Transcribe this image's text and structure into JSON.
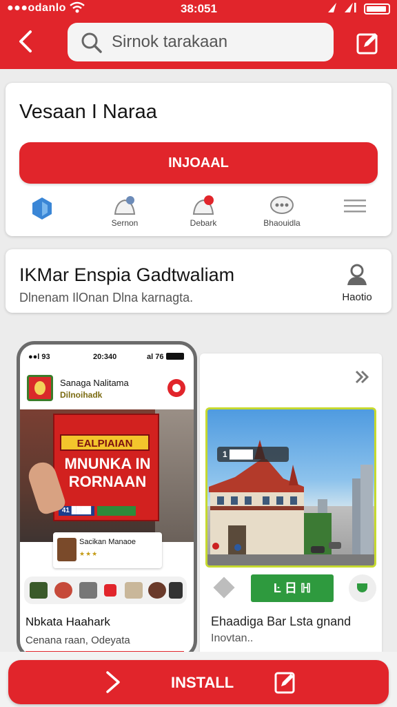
{
  "status_bar": {
    "carrier": "●●●odanlo",
    "time": "38:051"
  },
  "header": {
    "search_placeholder": "Sirnok tarakaan"
  },
  "app": {
    "title": "Vesaan  I Naraa",
    "install_label": "INJOAAL",
    "actions": [
      {
        "label": "",
        "icon": "shield-icon"
      },
      {
        "label": "Sernon",
        "icon": "bell-icon"
      },
      {
        "label": "Debark",
        "icon": "notification-bell-icon"
      },
      {
        "label": "Bhaouidla",
        "icon": "chat-bubble-icon"
      },
      {
        "label": "",
        "icon": "menu-icon"
      }
    ]
  },
  "developer": {
    "name": "IKMar Enspia Gadtwaliam",
    "description": "Dlnenam IlOnan Dlna karnagta.",
    "profile_label": "Haotio"
  },
  "screenshots": [
    {
      "status_carrier": "●●l 93",
      "status_time": "20:340",
      "status_right": "al 76",
      "header_title": "Sanaga Nalitama",
      "header_sub": "Dilnoihadk",
      "poster_top": "EALPIAIAN",
      "poster_main": "MNUNKA IN RORNAAN",
      "poster_tag": "41 ████",
      "card_name": "Sacikan Manaoe",
      "card_stars": "★★★",
      "name": "Nbkata Haahark",
      "description": "Cenana raan, Odeyata"
    },
    {
      "tag": "1 ████",
      "green_label": "Ŀ 日 ℍ",
      "name": "Ehaadiga Bar Lsta gnand",
      "description": "Inovtan.."
    }
  ],
  "bottom": {
    "install_label": "INSTALL"
  },
  "colors": {
    "accent": "#e1252b",
    "green": "#2e9a3e"
  }
}
